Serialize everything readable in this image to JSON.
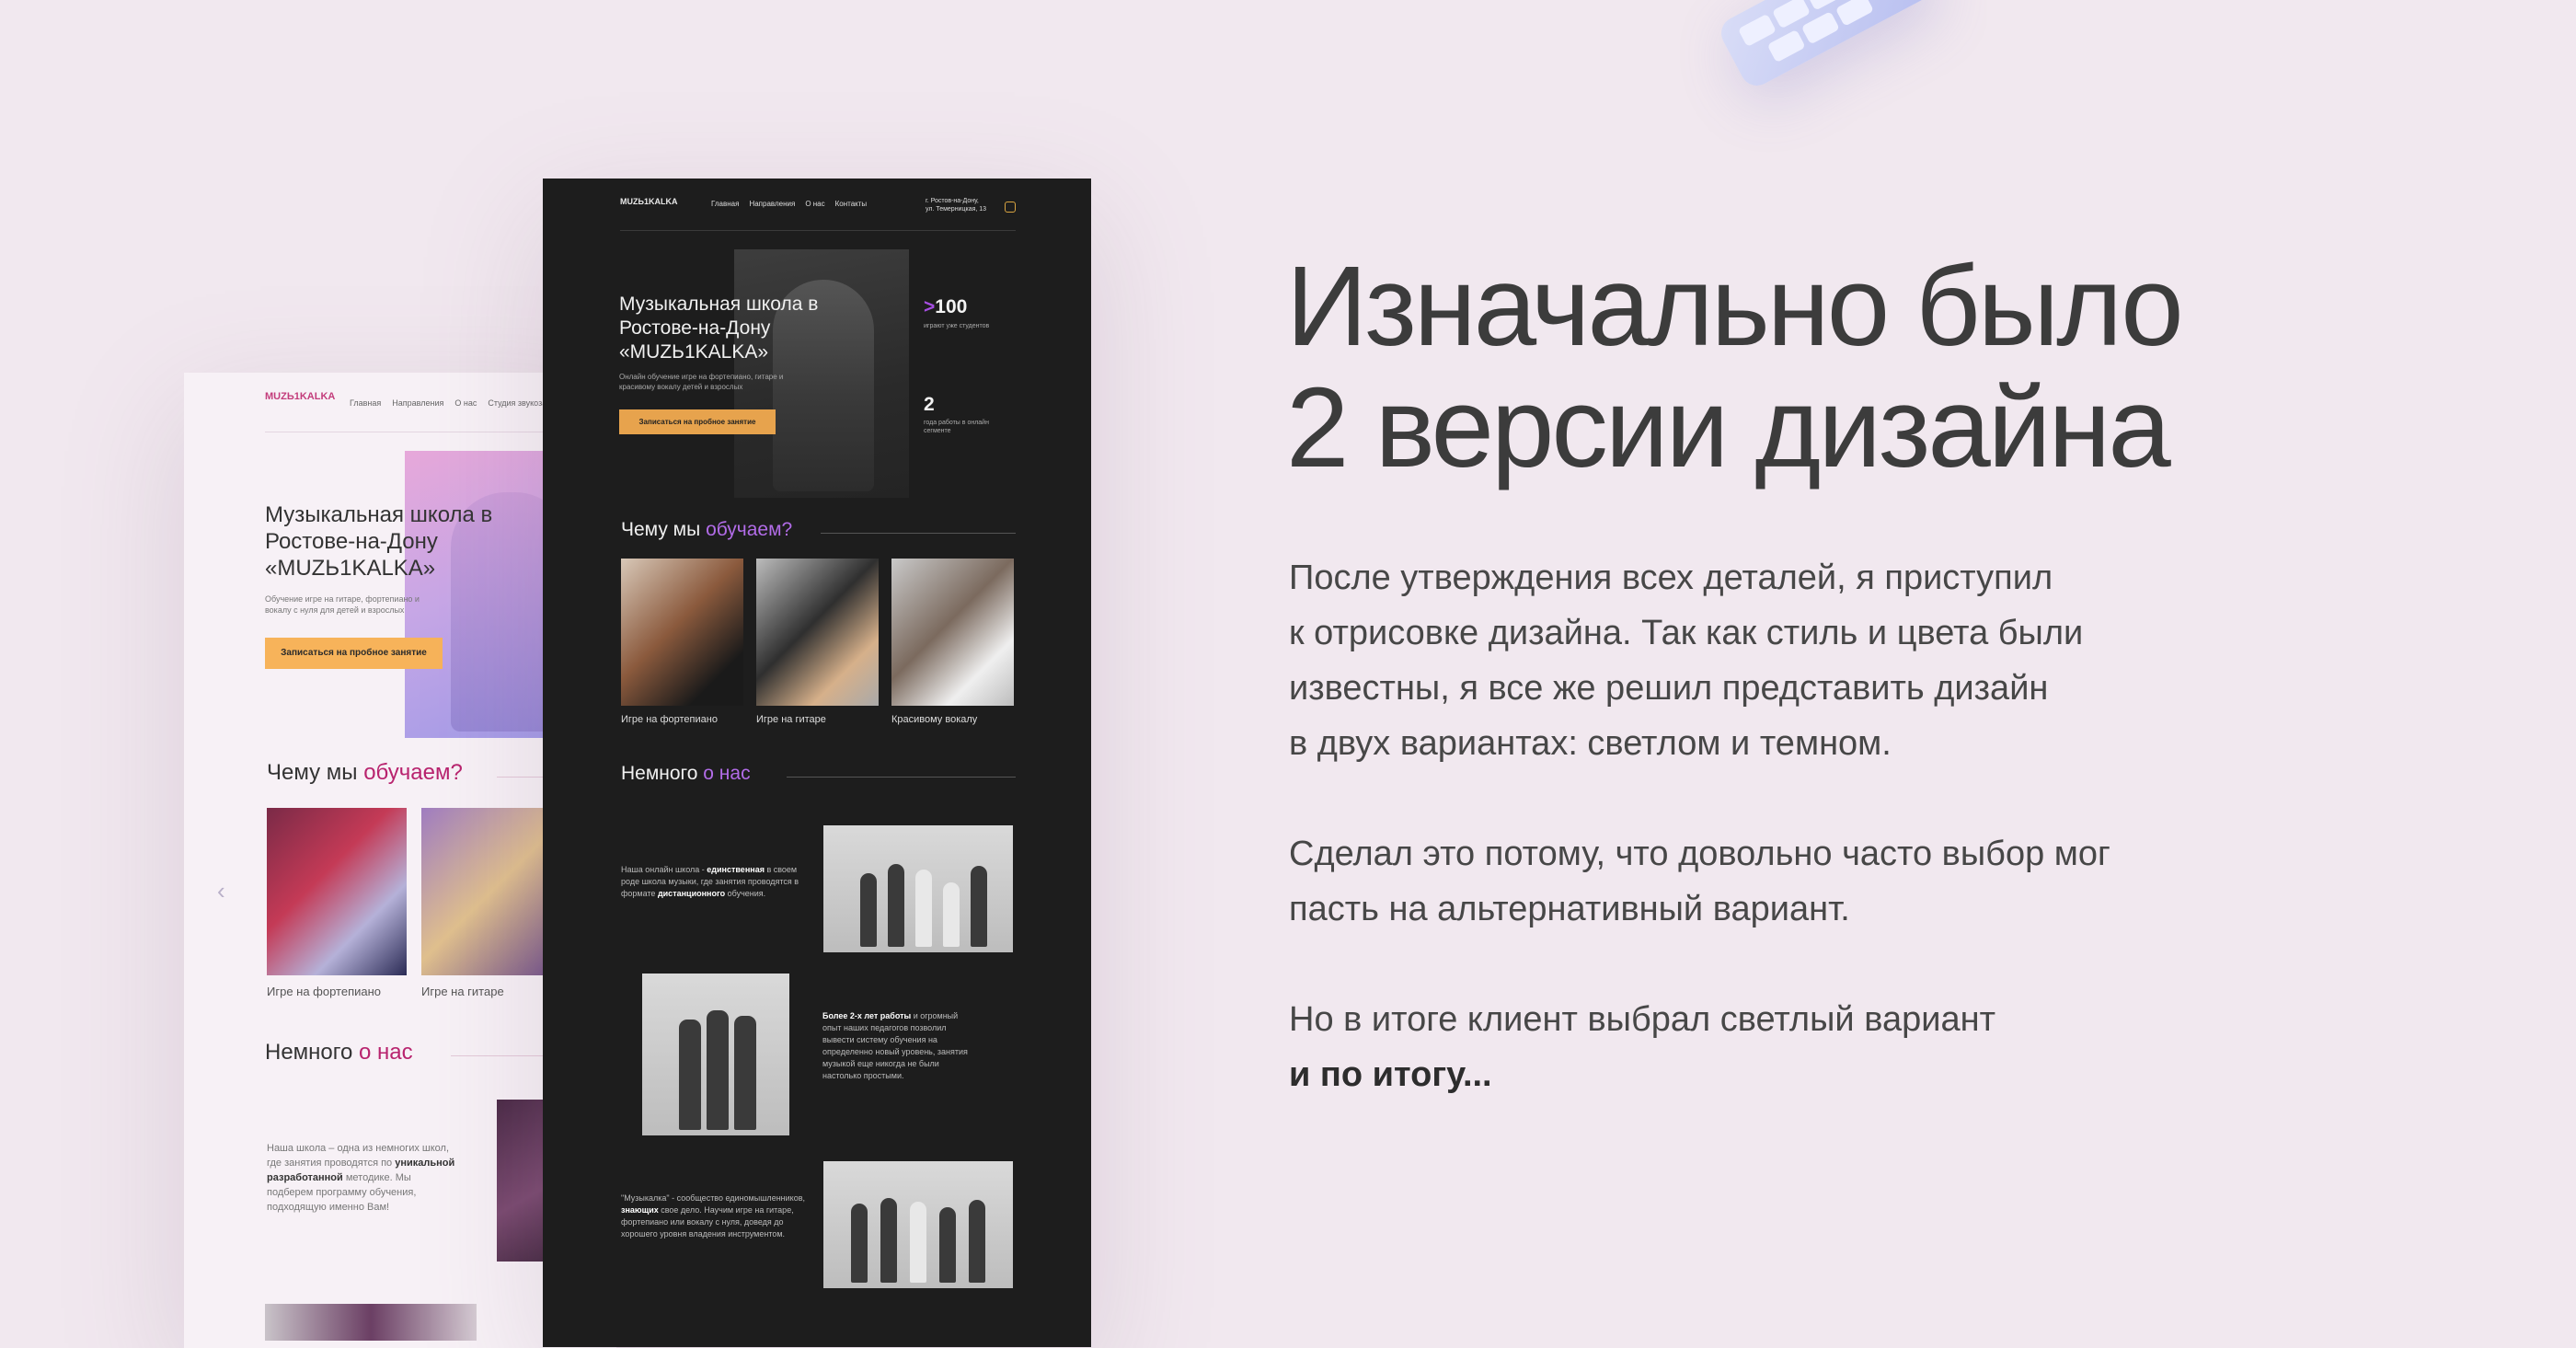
{
  "slide": {
    "headline_line1": "Изначально было",
    "headline_line2": "2 версии дизайна",
    "paragraph1": [
      "После утверждения всех деталей, я приступил",
      "к отрисовке дизайна. Так как стиль и цвета были",
      "известны, я все же решил представить дизайн",
      "в двух вариантах: светлом и темном."
    ],
    "paragraph2": [
      "Сделал это потому, что довольно часто выбор мог",
      "пасть на альтернативный вариант."
    ],
    "paragraph3_line1": "Но в итоге клиент выбрал светлый вариант",
    "paragraph3_bold": "и по итогу..."
  },
  "colors": {
    "background": "#f1e8ef",
    "dark_mockup_bg": "#1d1d1d",
    "light_accent": "#b8236e",
    "dark_accent": "#b26ce8",
    "cta": "#f7b35a"
  },
  "light": {
    "logo": "MUZЬ1KALKA",
    "nav": [
      "Главная",
      "Направления",
      "О нас",
      "Студия звукозаписи"
    ],
    "hero_title": "Музыкальная школа в Ростове-на-Дону «MUZЬ1KALKA»",
    "hero_sub": "Обучение игре на гитаре, фортепиано и вокалу с нуля для детей и взрослых",
    "cta": "Записаться на пробное занятие",
    "teach_title": "Чему мы ",
    "teach_accent": "обучаем?",
    "cards": [
      "Игре на фортепиано",
      "Игре на гитаре"
    ],
    "about_title": "Немного ",
    "about_accent": "о нас",
    "about_text_1": "Наша школа – одна из немногих школ, где занятия проводятся по ",
    "about_bold": "уникальной разработанной",
    "about_text_2": " методике. Мы подберем программу обучения, подходящую именно Вам!",
    "arrow": "‹"
  },
  "dark": {
    "logo": "MUZЬ1KALKA",
    "nav": [
      "Главная",
      "Направления",
      "О нас",
      "Контакты"
    ],
    "address": "г. Ростов-на-Дону,\nул. Темерницкая, 13",
    "hero_title": "Музыкальная школа в Ростове-на-Дону «MUZЬ1KALKA»",
    "hero_sub": "Онлайн обучение игре на фортепиано, гитаре и красивому вокалу детей и взрослых",
    "cta": "Записаться на пробное занятие",
    "stat1_prefix": ">",
    "stat1_num": "100",
    "stat1_label": "играют уже студентов",
    "stat2_num": "2",
    "stat2_label": "года работы в онлайн сегменте",
    "teach_title": "Чему мы ",
    "teach_accent": "обучаем?",
    "cards": [
      "Игре на фортепиано",
      "Игре на гитаре",
      "Красивому вокалу"
    ],
    "about_title": "Немного ",
    "about_accent": "о нас",
    "about1_a": "Наша онлайн школа - ",
    "about1_b": "единственная",
    "about1_c": " в своем роде школа музыки, где занятия проводятся в формате ",
    "about1_d": "дистанционного",
    "about1_e": " обучения.",
    "about2_b": "Более 2-х лет работы",
    "about2_c": " и огромный опыт наших педагогов позволил вывести систему обучения на определенно новый уровень, занятия музыкой еще никогда не были настолько простыми.",
    "about3_a": "\"Музыкалка\" - сообщество единомышленников, ",
    "about3_b": "знающих",
    "about3_c": " свое дело. Научим игре на гитаре, фортепиано или вокалу с нуля, доведя до хорошего уровня владения инструментом."
  }
}
